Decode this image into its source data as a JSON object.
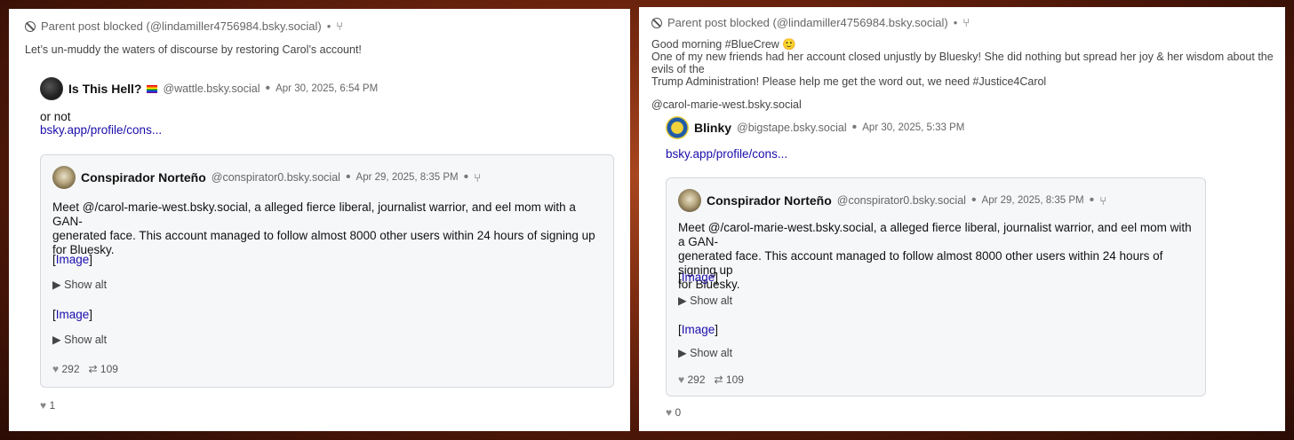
{
  "left": {
    "blocked_text": "Parent post blocked (@lindamiller4756984.bsky.social)",
    "post_text": "Let’s un-muddy the waters of discourse by restoring Carol’s account!",
    "quote": {
      "author": "Is This Hell?",
      "handle": "@wattle.bsky.social",
      "date": "Apr 30, 2025, 6:54 PM",
      "text": "or not",
      "link": "bsky.app/profile/cons..."
    },
    "likes": "1"
  },
  "right": {
    "blocked_text": "Parent post blocked (@lindamiller4756984.bsky.social)",
    "post_line1": "Good morning #BlueCrew 🙂",
    "post_line2": "One of my new friends had her account closed unjustly by Bluesky! She did nothing but spread her joy & her wisdom about the evils of the",
    "post_line3": "Trump Administration! Please help me get the word out, we need #Justice4Carol",
    "post_mention": "@carol-marie-west.bsky.social",
    "quote": {
      "author": "Blinky",
      "handle": "@bigstape.bsky.social",
      "date": "Apr 30, 2025, 5:33 PM",
      "link": "bsky.app/profile/cons..."
    },
    "likes": "0"
  },
  "nested": {
    "author": "Conspirador Norteño",
    "handle": "@conspirator0.bsky.social",
    "date": "Apr 29, 2025, 8:35 PM",
    "text_line1": "Meet @/carol-marie-west.bsky.social, a alleged fierce liberal, journalist warrior, and eel mom with a GAN-",
    "text_line2": "generated face. This account managed to follow almost 8000 other users within 24 hours of signing up",
    "text_line3": "for Bluesky.",
    "image_label": "Image",
    "show_alt": "Show alt",
    "likes": "292",
    "reposts": "109"
  },
  "separator": "•",
  "icons": [
    "blocked-icon",
    "fork-icon",
    "rainbow-flag-icon",
    "heart-icon",
    "repost-icon",
    "disclosure-triangle-icon"
  ]
}
